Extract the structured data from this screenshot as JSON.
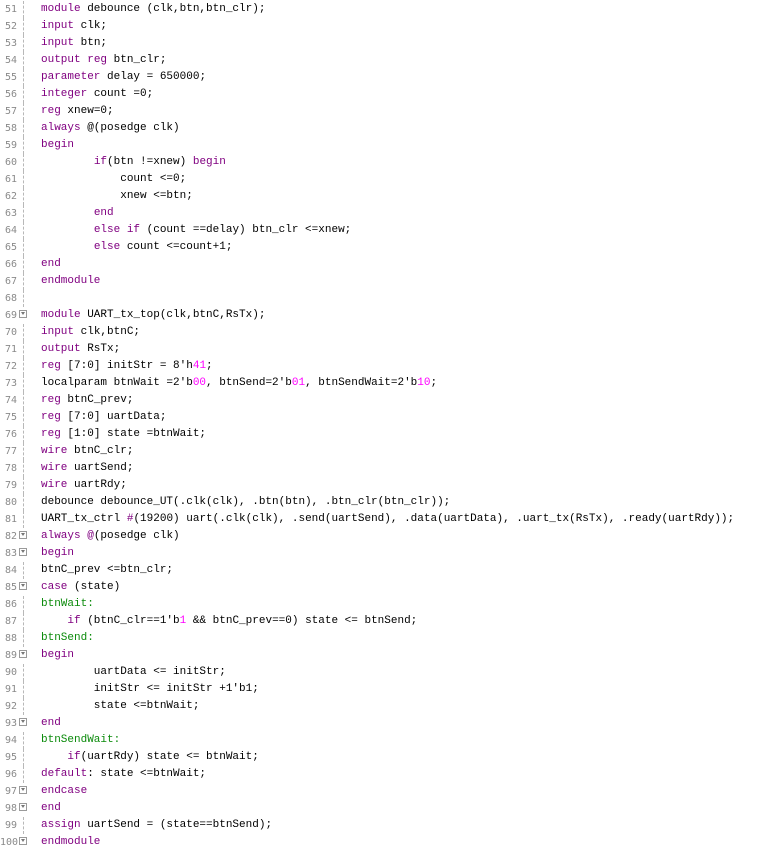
{
  "colors": {
    "keyword": "#800080",
    "number": "#ff00ff",
    "label": "#0a8a0a",
    "text": "#000000",
    "line_number": "#8a8a8a"
  },
  "lines": [
    {
      "n": "51",
      "fold": false,
      "segs": [
        {
          "c": "kw",
          "t": "module"
        },
        {
          "c": "",
          "t": " debounce (clk,btn,btn_clr);"
        }
      ]
    },
    {
      "n": "52",
      "fold": false,
      "segs": [
        {
          "c": "kw",
          "t": "input"
        },
        {
          "c": "",
          "t": " clk;"
        }
      ]
    },
    {
      "n": "53",
      "fold": false,
      "segs": [
        {
          "c": "kw",
          "t": "input"
        },
        {
          "c": "",
          "t": " btn;"
        }
      ]
    },
    {
      "n": "54",
      "fold": false,
      "segs": [
        {
          "c": "kw",
          "t": "output"
        },
        {
          "c": "",
          "t": " "
        },
        {
          "c": "kw",
          "t": "reg"
        },
        {
          "c": "",
          "t": " btn_clr;"
        }
      ]
    },
    {
      "n": "55",
      "fold": false,
      "segs": [
        {
          "c": "kw",
          "t": "parameter"
        },
        {
          "c": "",
          "t": " delay = 650000;"
        }
      ]
    },
    {
      "n": "56",
      "fold": false,
      "segs": [
        {
          "c": "kw",
          "t": "integer"
        },
        {
          "c": "",
          "t": " count =0;"
        }
      ]
    },
    {
      "n": "57",
      "fold": false,
      "segs": [
        {
          "c": "kw",
          "t": "reg"
        },
        {
          "c": "",
          "t": " xnew=0;"
        }
      ]
    },
    {
      "n": "58",
      "fold": false,
      "segs": [
        {
          "c": "kw",
          "t": "always"
        },
        {
          "c": "",
          "t": " @(posedge clk)"
        }
      ]
    },
    {
      "n": "59",
      "fold": false,
      "segs": [
        {
          "c": "kw",
          "t": "begin"
        }
      ]
    },
    {
      "n": "60",
      "fold": false,
      "segs": [
        {
          "c": "",
          "t": "        "
        },
        {
          "c": "kw",
          "t": "if"
        },
        {
          "c": "",
          "t": "(btn !=xnew) "
        },
        {
          "c": "kw",
          "t": "begin"
        }
      ]
    },
    {
      "n": "61",
      "fold": false,
      "segs": [
        {
          "c": "",
          "t": "            count <=0;"
        }
      ]
    },
    {
      "n": "62",
      "fold": false,
      "segs": [
        {
          "c": "",
          "t": "            xnew <=btn;"
        }
      ]
    },
    {
      "n": "63",
      "fold": false,
      "segs": [
        {
          "c": "",
          "t": "        "
        },
        {
          "c": "kw",
          "t": "end"
        }
      ]
    },
    {
      "n": "64",
      "fold": false,
      "segs": [
        {
          "c": "",
          "t": "        "
        },
        {
          "c": "kw",
          "t": "else"
        },
        {
          "c": "",
          "t": " "
        },
        {
          "c": "kw",
          "t": "if"
        },
        {
          "c": "",
          "t": " (count ==delay) btn_clr <=xnew;"
        }
      ]
    },
    {
      "n": "65",
      "fold": false,
      "segs": [
        {
          "c": "",
          "t": "        "
        },
        {
          "c": "kw",
          "t": "else"
        },
        {
          "c": "",
          "t": " count <=count+1;"
        }
      ]
    },
    {
      "n": "66",
      "fold": false,
      "segs": [
        {
          "c": "kw",
          "t": "end"
        }
      ]
    },
    {
      "n": "67",
      "fold": false,
      "segs": [
        {
          "c": "kw",
          "t": "endmodule"
        }
      ]
    },
    {
      "n": "68",
      "fold": false,
      "segs": []
    },
    {
      "n": "69",
      "fold": true,
      "segs": [
        {
          "c": "kw",
          "t": "module"
        },
        {
          "c": "",
          "t": " UART_tx_top(clk,btnC,RsTx);"
        }
      ]
    },
    {
      "n": "70",
      "fold": false,
      "segs": [
        {
          "c": "kw",
          "t": "input"
        },
        {
          "c": "",
          "t": " clk,btnC;"
        }
      ]
    },
    {
      "n": "71",
      "fold": false,
      "segs": [
        {
          "c": "kw",
          "t": "output"
        },
        {
          "c": "",
          "t": " RsTx;"
        }
      ]
    },
    {
      "n": "72",
      "fold": false,
      "segs": [
        {
          "c": "kw",
          "t": "reg"
        },
        {
          "c": "",
          "t": " [7:0] initStr = 8'h"
        },
        {
          "c": "num",
          "t": "41"
        },
        {
          "c": "",
          "t": ";"
        }
      ]
    },
    {
      "n": "73",
      "fold": false,
      "segs": [
        {
          "c": "",
          "t": "localparam btnWait =2'b"
        },
        {
          "c": "num",
          "t": "00"
        },
        {
          "c": "",
          "t": ", btnSend=2'b"
        },
        {
          "c": "num",
          "t": "01"
        },
        {
          "c": "",
          "t": ", btnSendWait=2'b"
        },
        {
          "c": "num",
          "t": "10"
        },
        {
          "c": "",
          "t": ";"
        }
      ]
    },
    {
      "n": "74",
      "fold": false,
      "segs": [
        {
          "c": "kw",
          "t": "reg"
        },
        {
          "c": "",
          "t": " btnC_prev;"
        }
      ]
    },
    {
      "n": "75",
      "fold": false,
      "segs": [
        {
          "c": "kw",
          "t": "reg"
        },
        {
          "c": "",
          "t": " [7:0] uartData;"
        }
      ]
    },
    {
      "n": "76",
      "fold": false,
      "segs": [
        {
          "c": "kw",
          "t": "reg"
        },
        {
          "c": "",
          "t": " [1:0] state =btnWait;"
        }
      ]
    },
    {
      "n": "77",
      "fold": false,
      "segs": [
        {
          "c": "kw",
          "t": "wire"
        },
        {
          "c": "",
          "t": " btnC_clr;"
        }
      ]
    },
    {
      "n": "78",
      "fold": false,
      "segs": [
        {
          "c": "kw",
          "t": "wire"
        },
        {
          "c": "",
          "t": " uartSend;"
        }
      ]
    },
    {
      "n": "79",
      "fold": false,
      "segs": [
        {
          "c": "kw",
          "t": "wire"
        },
        {
          "c": "",
          "t": " uartRdy;"
        }
      ]
    },
    {
      "n": "80",
      "fold": false,
      "segs": [
        {
          "c": "",
          "t": "debounce debounce_UT(.clk(clk), .btn(btn), .btn_clr(btn_clr));"
        }
      ]
    },
    {
      "n": "81",
      "fold": false,
      "segs": [
        {
          "c": "",
          "t": "UART_tx_ctrl "
        },
        {
          "c": "kw",
          "t": "#"
        },
        {
          "c": "",
          "t": "(19200) uart(.clk(clk), .send(uartSend), .data(uartData), .uart_tx(RsTx), .ready(uartRdy));"
        }
      ]
    },
    {
      "n": "82",
      "fold": true,
      "segs": [
        {
          "c": "kw",
          "t": "always"
        },
        {
          "c": "",
          "t": " "
        },
        {
          "c": "kw",
          "t": "@"
        },
        {
          "c": "",
          "t": "(posedge clk)"
        }
      ]
    },
    {
      "n": "83",
      "fold": true,
      "segs": [
        {
          "c": "kw",
          "t": "begin"
        }
      ]
    },
    {
      "n": "84",
      "fold": false,
      "segs": [
        {
          "c": "",
          "t": "btnC_prev <=btn_clr;"
        }
      ]
    },
    {
      "n": "85",
      "fold": true,
      "segs": [
        {
          "c": "kw",
          "t": "case"
        },
        {
          "c": "",
          "t": " (state)"
        }
      ]
    },
    {
      "n": "86",
      "fold": false,
      "segs": [
        {
          "c": "lbl",
          "t": "btnWait:"
        }
      ]
    },
    {
      "n": "87",
      "fold": false,
      "segs": [
        {
          "c": "",
          "t": "    "
        },
        {
          "c": "kw",
          "t": "if"
        },
        {
          "c": "",
          "t": " (btnC_clr==1'b"
        },
        {
          "c": "num",
          "t": "1"
        },
        {
          "c": "",
          "t": " && btnC_prev==0) state <= btnSend;"
        }
      ]
    },
    {
      "n": "88",
      "fold": false,
      "segs": [
        {
          "c": "lbl",
          "t": "btnSend:"
        }
      ]
    },
    {
      "n": "89",
      "fold": true,
      "segs": [
        {
          "c": "kw",
          "t": "begin"
        }
      ]
    },
    {
      "n": "90",
      "fold": false,
      "segs": [
        {
          "c": "",
          "t": "        uartData <= initStr;"
        }
      ]
    },
    {
      "n": "91",
      "fold": false,
      "segs": [
        {
          "c": "",
          "t": "        initStr <= initStr +1'b1;"
        }
      ]
    },
    {
      "n": "92",
      "fold": false,
      "segs": [
        {
          "c": "",
          "t": "        state <=btnWait;"
        }
      ]
    },
    {
      "n": "93",
      "fold": true,
      "segs": [
        {
          "c": "kw",
          "t": "end"
        }
      ]
    },
    {
      "n": "94",
      "fold": false,
      "segs": [
        {
          "c": "lbl",
          "t": "btnSendWait:"
        }
      ]
    },
    {
      "n": "95",
      "fold": false,
      "segs": [
        {
          "c": "",
          "t": "    "
        },
        {
          "c": "kw",
          "t": "if"
        },
        {
          "c": "",
          "t": "(uartRdy) state <= btnWait;"
        }
      ]
    },
    {
      "n": "96",
      "fold": false,
      "segs": [
        {
          "c": "kw",
          "t": "default"
        },
        {
          "c": "",
          "t": ": state <=btnWait;"
        }
      ]
    },
    {
      "n": "97",
      "fold": true,
      "segs": [
        {
          "c": "kw",
          "t": "endcase"
        }
      ]
    },
    {
      "n": "98",
      "fold": true,
      "segs": [
        {
          "c": "kw",
          "t": "end"
        }
      ]
    },
    {
      "n": "99",
      "fold": false,
      "segs": [
        {
          "c": "kw",
          "t": "assign"
        },
        {
          "c": "",
          "t": " uartSend = (state==btnSend);"
        }
      ]
    },
    {
      "n": "100",
      "fold": true,
      "segs": [
        {
          "c": "kw",
          "t": "endmodule"
        }
      ]
    }
  ]
}
